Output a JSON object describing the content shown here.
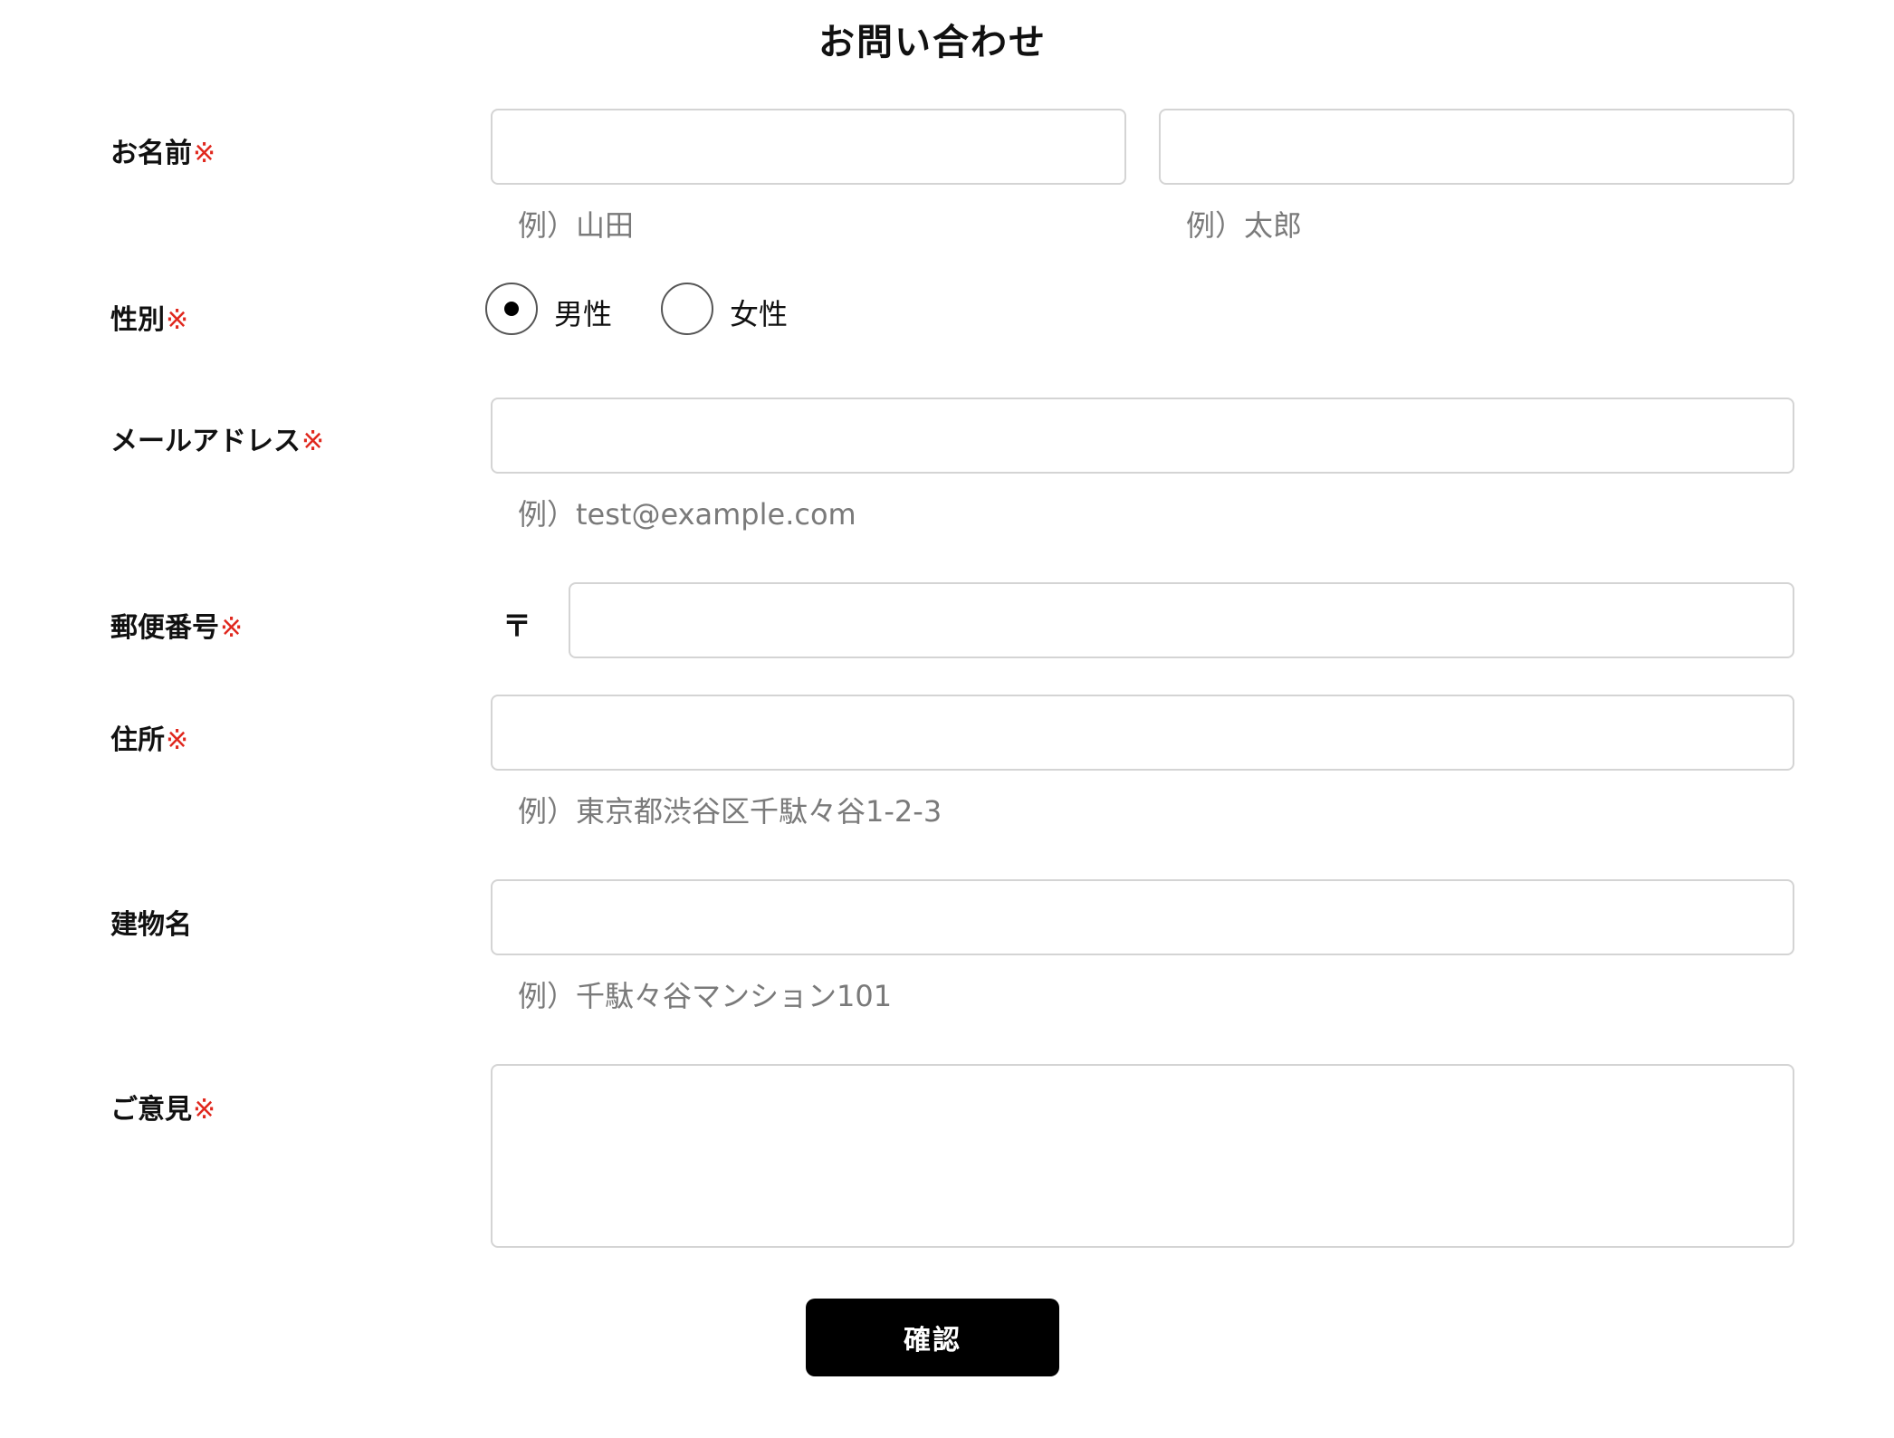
{
  "form": {
    "title": "お問い合わせ",
    "required_mark": "※",
    "name": {
      "label": "お名前",
      "last_value": "",
      "first_value": "",
      "last_hint": "例）山田",
      "first_hint": "例）太郎"
    },
    "gender": {
      "label": "性別",
      "options": [
        "男性",
        "女性"
      ],
      "selected": "男性"
    },
    "email": {
      "label": "メールアドレス",
      "value": "",
      "hint": "例）test@example.com"
    },
    "postal": {
      "label": "郵便番号",
      "symbol": "〒",
      "value": ""
    },
    "address": {
      "label": "住所",
      "value": "",
      "hint": "例）東京都渋谷区千駄々谷1-2-3"
    },
    "building": {
      "label": "建物名",
      "value": "",
      "hint": "例）千駄々谷マンション101"
    },
    "opinion": {
      "label": "ご意見",
      "value": ""
    },
    "submit_label": "確認"
  }
}
